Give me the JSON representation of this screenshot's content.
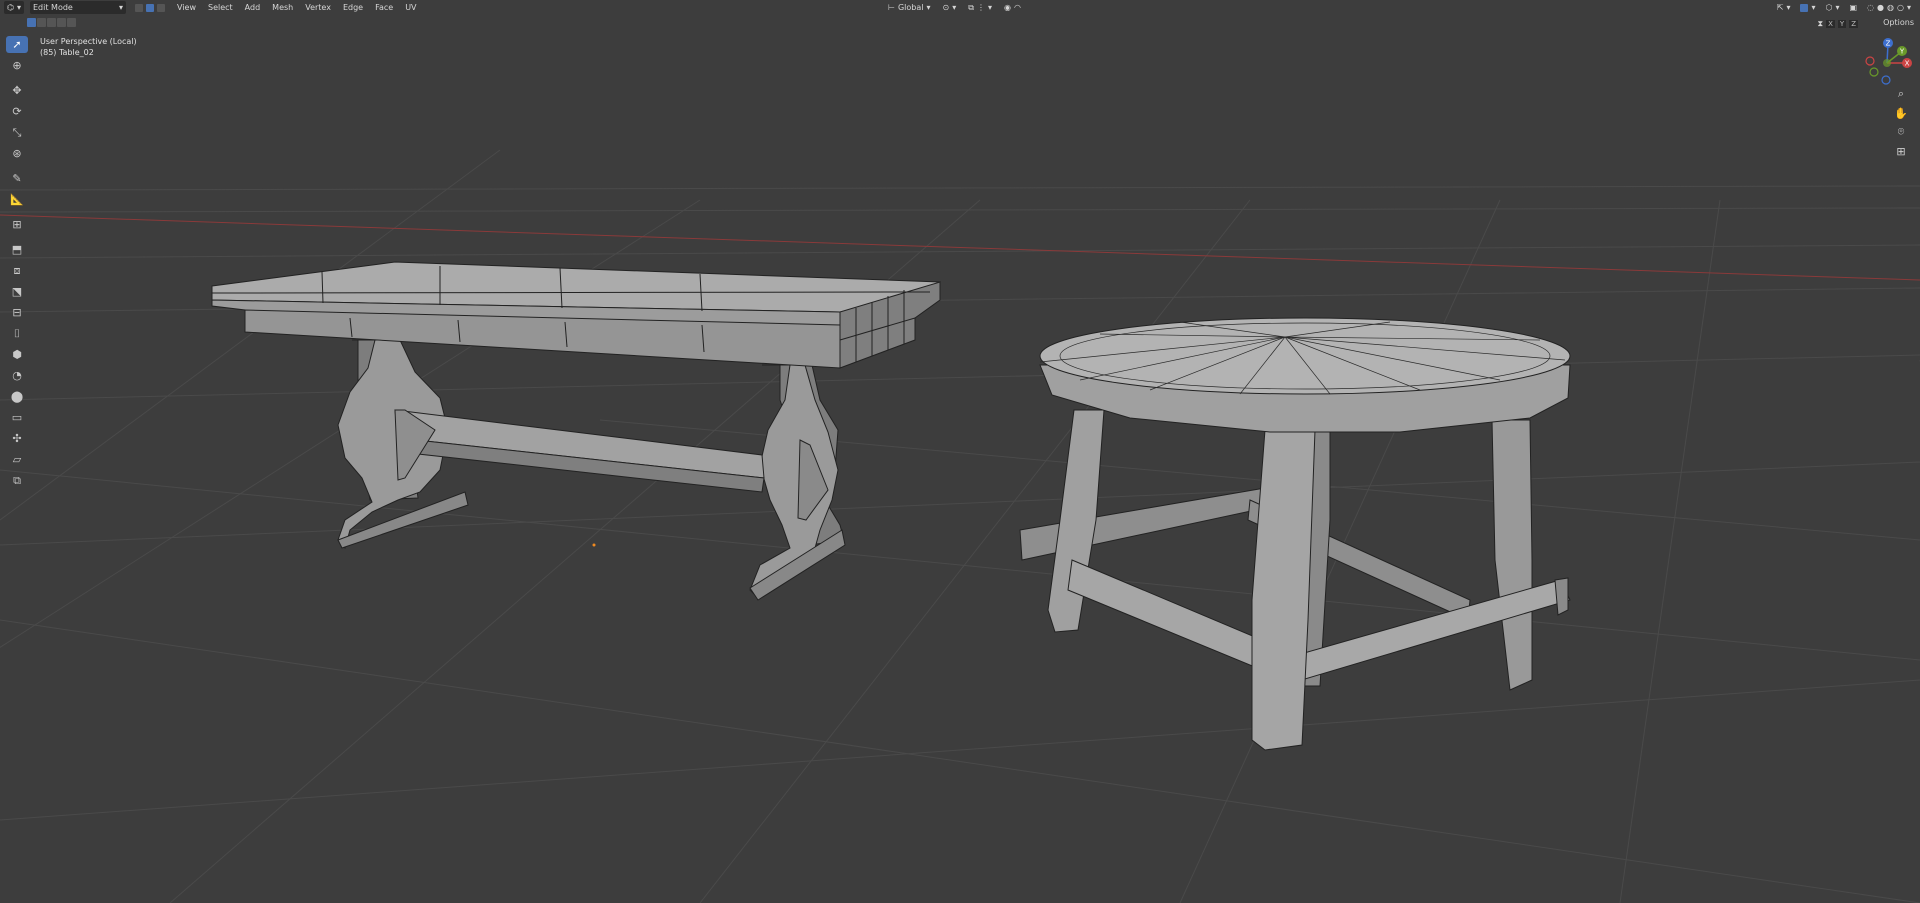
{
  "header": {
    "mode": "Edit Mode",
    "menus": [
      "View",
      "Select",
      "Add",
      "Mesh",
      "Vertex",
      "Edge",
      "Face",
      "UV"
    ],
    "transform_orientation": "Global"
  },
  "subheader": {
    "axes": [
      "X",
      "Y",
      "Z"
    ],
    "options_label": "Options"
  },
  "viewport": {
    "view_name": "User Perspective (Local)",
    "object_label": "(85) Table_02"
  },
  "gizmo": {
    "x_label": "X",
    "y_label": "Y",
    "z_label": "Z"
  },
  "colors": {
    "background": "#3d3d3d",
    "grid": "#4a4a4a",
    "x_axis_line": "#8a3a3a",
    "active_tool": "#4772b3",
    "mesh_face": "#9a9a9a",
    "mesh_edge": "#222222"
  },
  "toolbar": {
    "icons": [
      "cursor-select-icon",
      "3d-cursor-icon",
      "move-icon",
      "rotate-icon",
      "scale-icon",
      "transform-icon",
      "annotate-icon",
      "measure-icon",
      "add-cube-icon",
      "extrude-icon",
      "inset-icon",
      "bevel-icon",
      "loop-cut-icon",
      "knife-icon",
      "poly-build-icon",
      "spin-icon",
      "smooth-icon",
      "edge-slide-icon",
      "shrink-fatten-icon",
      "shear-icon",
      "rip-region-icon"
    ]
  }
}
